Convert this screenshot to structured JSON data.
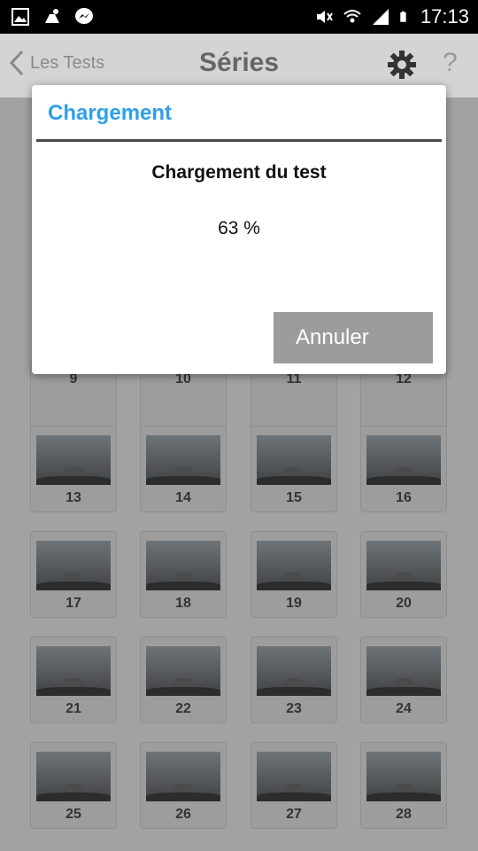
{
  "status_bar": {
    "time": "17:13"
  },
  "app_bar": {
    "back_label": "Les Tests",
    "title": "Séries",
    "help_label": "?"
  },
  "grid": {
    "cells": [
      "9",
      "10",
      "11",
      "12",
      "13",
      "14",
      "15",
      "16",
      "17",
      "18",
      "19",
      "20",
      "21",
      "22",
      "23",
      "24",
      "25",
      "26",
      "27",
      "28"
    ]
  },
  "dialog": {
    "title": "Chargement",
    "message": "Chargement du test",
    "progress_text": "63 %",
    "cancel_label": "Annuler",
    "accent_color": "#2ea0e8"
  }
}
